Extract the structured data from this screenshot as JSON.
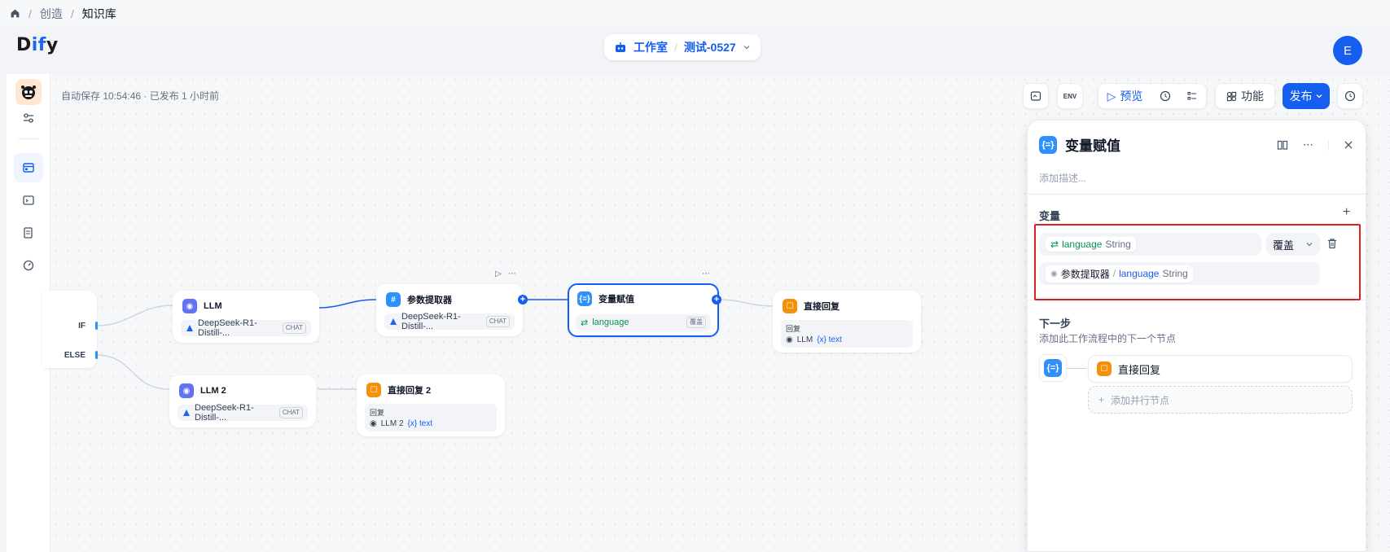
{
  "breadcrumb": {
    "home_icon": "home-icon",
    "items": [
      "创造",
      "知识库"
    ]
  },
  "app": {
    "logo_prefix": "D",
    "logo_highlight": "if",
    "logo_suffix": "y"
  },
  "workspace": {
    "studio_label": "工作室",
    "app_name": "测试-0527"
  },
  "user": {
    "avatar_letter": "E"
  },
  "status": {
    "autosave": "自动保存 10:54:46 · 已发布 1 小时前"
  },
  "toolbar": {
    "preview_label": "预览",
    "features_label": "功能",
    "publish_label": "发布"
  },
  "nodes": {
    "if_branch": {
      "if_label": "IF",
      "else_label": "ELSE"
    },
    "llm1": {
      "title": "LLM",
      "model": "DeepSeek-R1-Distill-...",
      "tag": "CHAT"
    },
    "llm2": {
      "title": "LLM 2",
      "model": "DeepSeek-R1-Distill-...",
      "tag": "CHAT"
    },
    "param_extractor": {
      "title": "参数提取器",
      "model": "DeepSeek-R1-Distill-...",
      "tag": "CHAT"
    },
    "assigner": {
      "title": "变量赋值",
      "var": "language",
      "mode": "覆盖"
    },
    "reply1": {
      "title": "直接回复",
      "block_label": "回复",
      "src": "LLM",
      "var": "{x} text"
    },
    "reply2": {
      "title": "直接回复 2",
      "block_label": "回复",
      "src": "LLM 2",
      "var": "{x} text"
    }
  },
  "panel": {
    "title": "变量赋值",
    "description_placeholder": "添加描述...",
    "variables_label": "变量",
    "target_var": {
      "name": "language",
      "type": "String"
    },
    "mode": "覆盖",
    "source": {
      "node": "参数提取器",
      "sep": "/",
      "name": "language",
      "type": "String"
    },
    "next_step_label": "下一步",
    "next_step_sub": "添加此工作流程中的下一个节点",
    "next_node": "直接回复",
    "add_parallel": "添加并行节点"
  },
  "colors": {
    "accent": "#155eef",
    "highlight_box": "#e11d1d",
    "assigner": "#2e90fa",
    "reply": "#f79009",
    "llm": "#6172f3"
  }
}
